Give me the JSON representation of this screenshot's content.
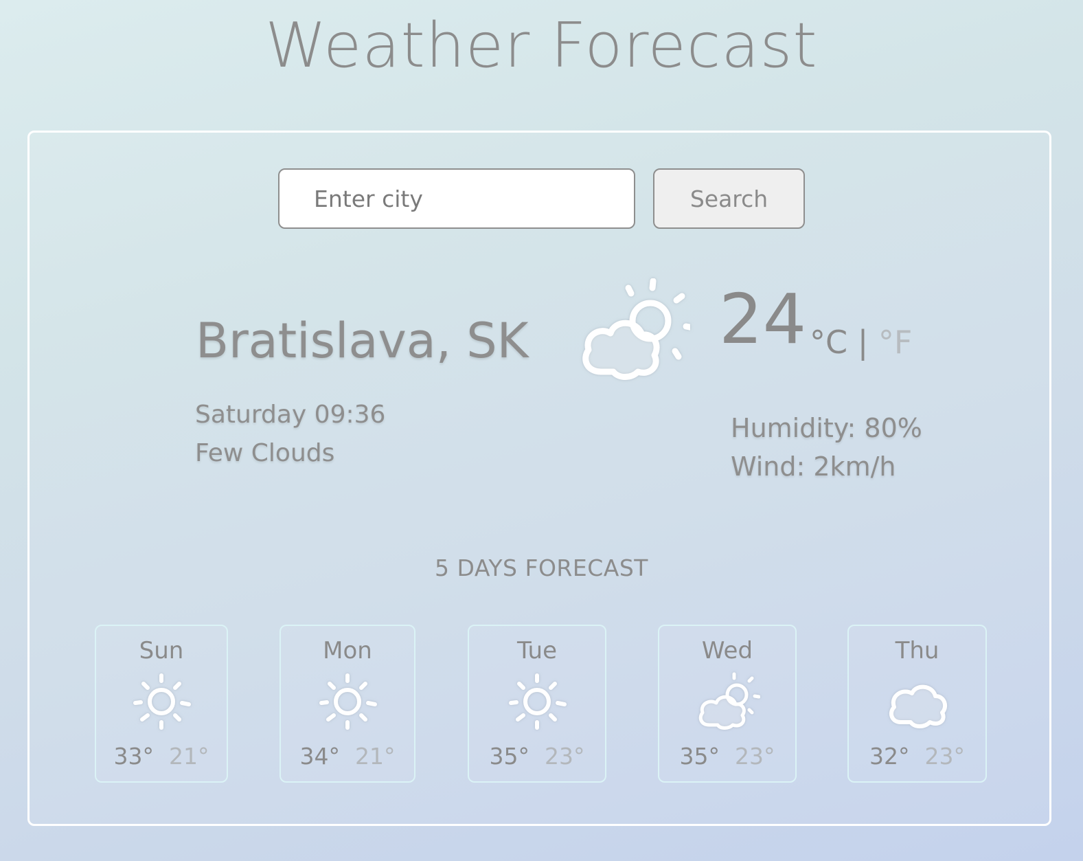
{
  "header": {
    "title": "Weather Forecast"
  },
  "search": {
    "placeholder": "Enter city",
    "button_label": "Search"
  },
  "current": {
    "city": "Bratislava, SK",
    "datetime": "Saturday 09:36",
    "condition": "Few Clouds",
    "icon": "few-clouds-icon",
    "temperature": "24",
    "unit_c": "°C",
    "unit_separator": "|",
    "unit_f": "°F",
    "humidity": "Humidity: 80%",
    "wind": "Wind: 2km/h"
  },
  "forecast": {
    "title": "5 DAYS FORECAST",
    "days": [
      {
        "day": "Sun",
        "icon": "sun-icon",
        "max": "33°",
        "min": "21°"
      },
      {
        "day": "Mon",
        "icon": "sun-icon",
        "max": "34°",
        "min": "21°"
      },
      {
        "day": "Tue",
        "icon": "sun-icon",
        "max": "35°",
        "min": "23°"
      },
      {
        "day": "Wed",
        "icon": "few-clouds-icon",
        "max": "35°",
        "min": "23°"
      },
      {
        "day": "Thu",
        "icon": "cloud-icon",
        "max": "32°",
        "min": "23°"
      }
    ]
  },
  "colors": {
    "text": "#8a8a8a",
    "muted": "#b5b9bd",
    "card_border": "#ffffff",
    "day_border": "#dbf3f6"
  }
}
